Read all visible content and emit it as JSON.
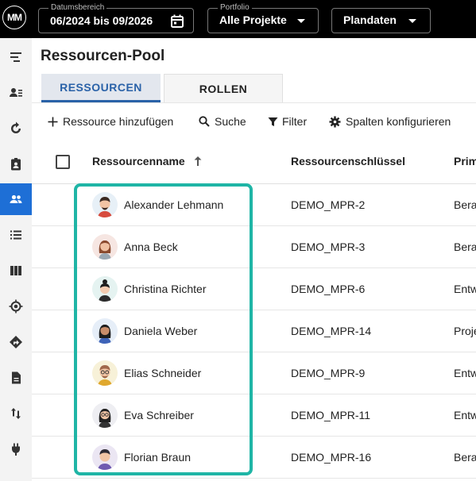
{
  "topbar": {
    "logo_text": "MM",
    "date_range": {
      "label": "Datumsbereich",
      "value": "06/2024 bis 09/2026"
    },
    "portfolio": {
      "label": "Portfolio",
      "value": "Alle Projekte"
    },
    "data_type": {
      "value": "Plandaten"
    }
  },
  "sidebar": {
    "items": [
      {
        "icon": "gantt-icon"
      },
      {
        "icon": "person-list-icon"
      },
      {
        "icon": "refresh-icon"
      },
      {
        "icon": "badge-icon"
      },
      {
        "icon": "people-icon",
        "active": true
      },
      {
        "icon": "list-icon"
      },
      {
        "icon": "columns-icon"
      },
      {
        "icon": "target-icon"
      },
      {
        "icon": "directions-icon"
      },
      {
        "icon": "document-icon"
      },
      {
        "icon": "swap-vertical-icon"
      },
      {
        "icon": "plug-icon"
      }
    ],
    "active_color": "#1e6fd6"
  },
  "page": {
    "title": "Ressourcen-Pool",
    "tabs": [
      {
        "label": "RESSOURCEN",
        "active": true
      },
      {
        "label": "ROLLEN",
        "active": false
      }
    ]
  },
  "toolbar": {
    "add_label": "Ressource hinzufügen",
    "search_label": "Suche",
    "filter_label": "Filter",
    "columns_label": "Spalten konfigurieren"
  },
  "table": {
    "columns": [
      "Ressourcenname",
      "Ressourcenschlüssel",
      "Prim"
    ],
    "rows": [
      {
        "name": "Alexander Lehmann",
        "key": "DEMO_MPR-2",
        "role": "Bera"
      },
      {
        "name": "Anna Beck",
        "key": "DEMO_MPR-3",
        "role": "Bera"
      },
      {
        "name": "Christina Richter",
        "key": "DEMO_MPR-6",
        "role": "Entw"
      },
      {
        "name": "Daniela Weber",
        "key": "DEMO_MPR-14",
        "role": "Proje"
      },
      {
        "name": "Elias Schneider",
        "key": "DEMO_MPR-9",
        "role": "Entw"
      },
      {
        "name": "Eva Schreiber",
        "key": "DEMO_MPR-11",
        "role": "Entw"
      },
      {
        "name": "Florian Braun",
        "key": "DEMO_MPR-16",
        "role": "Bera"
      }
    ]
  },
  "colors": {
    "accent": "#2a62a8",
    "highlight": "#1fb5a6"
  }
}
